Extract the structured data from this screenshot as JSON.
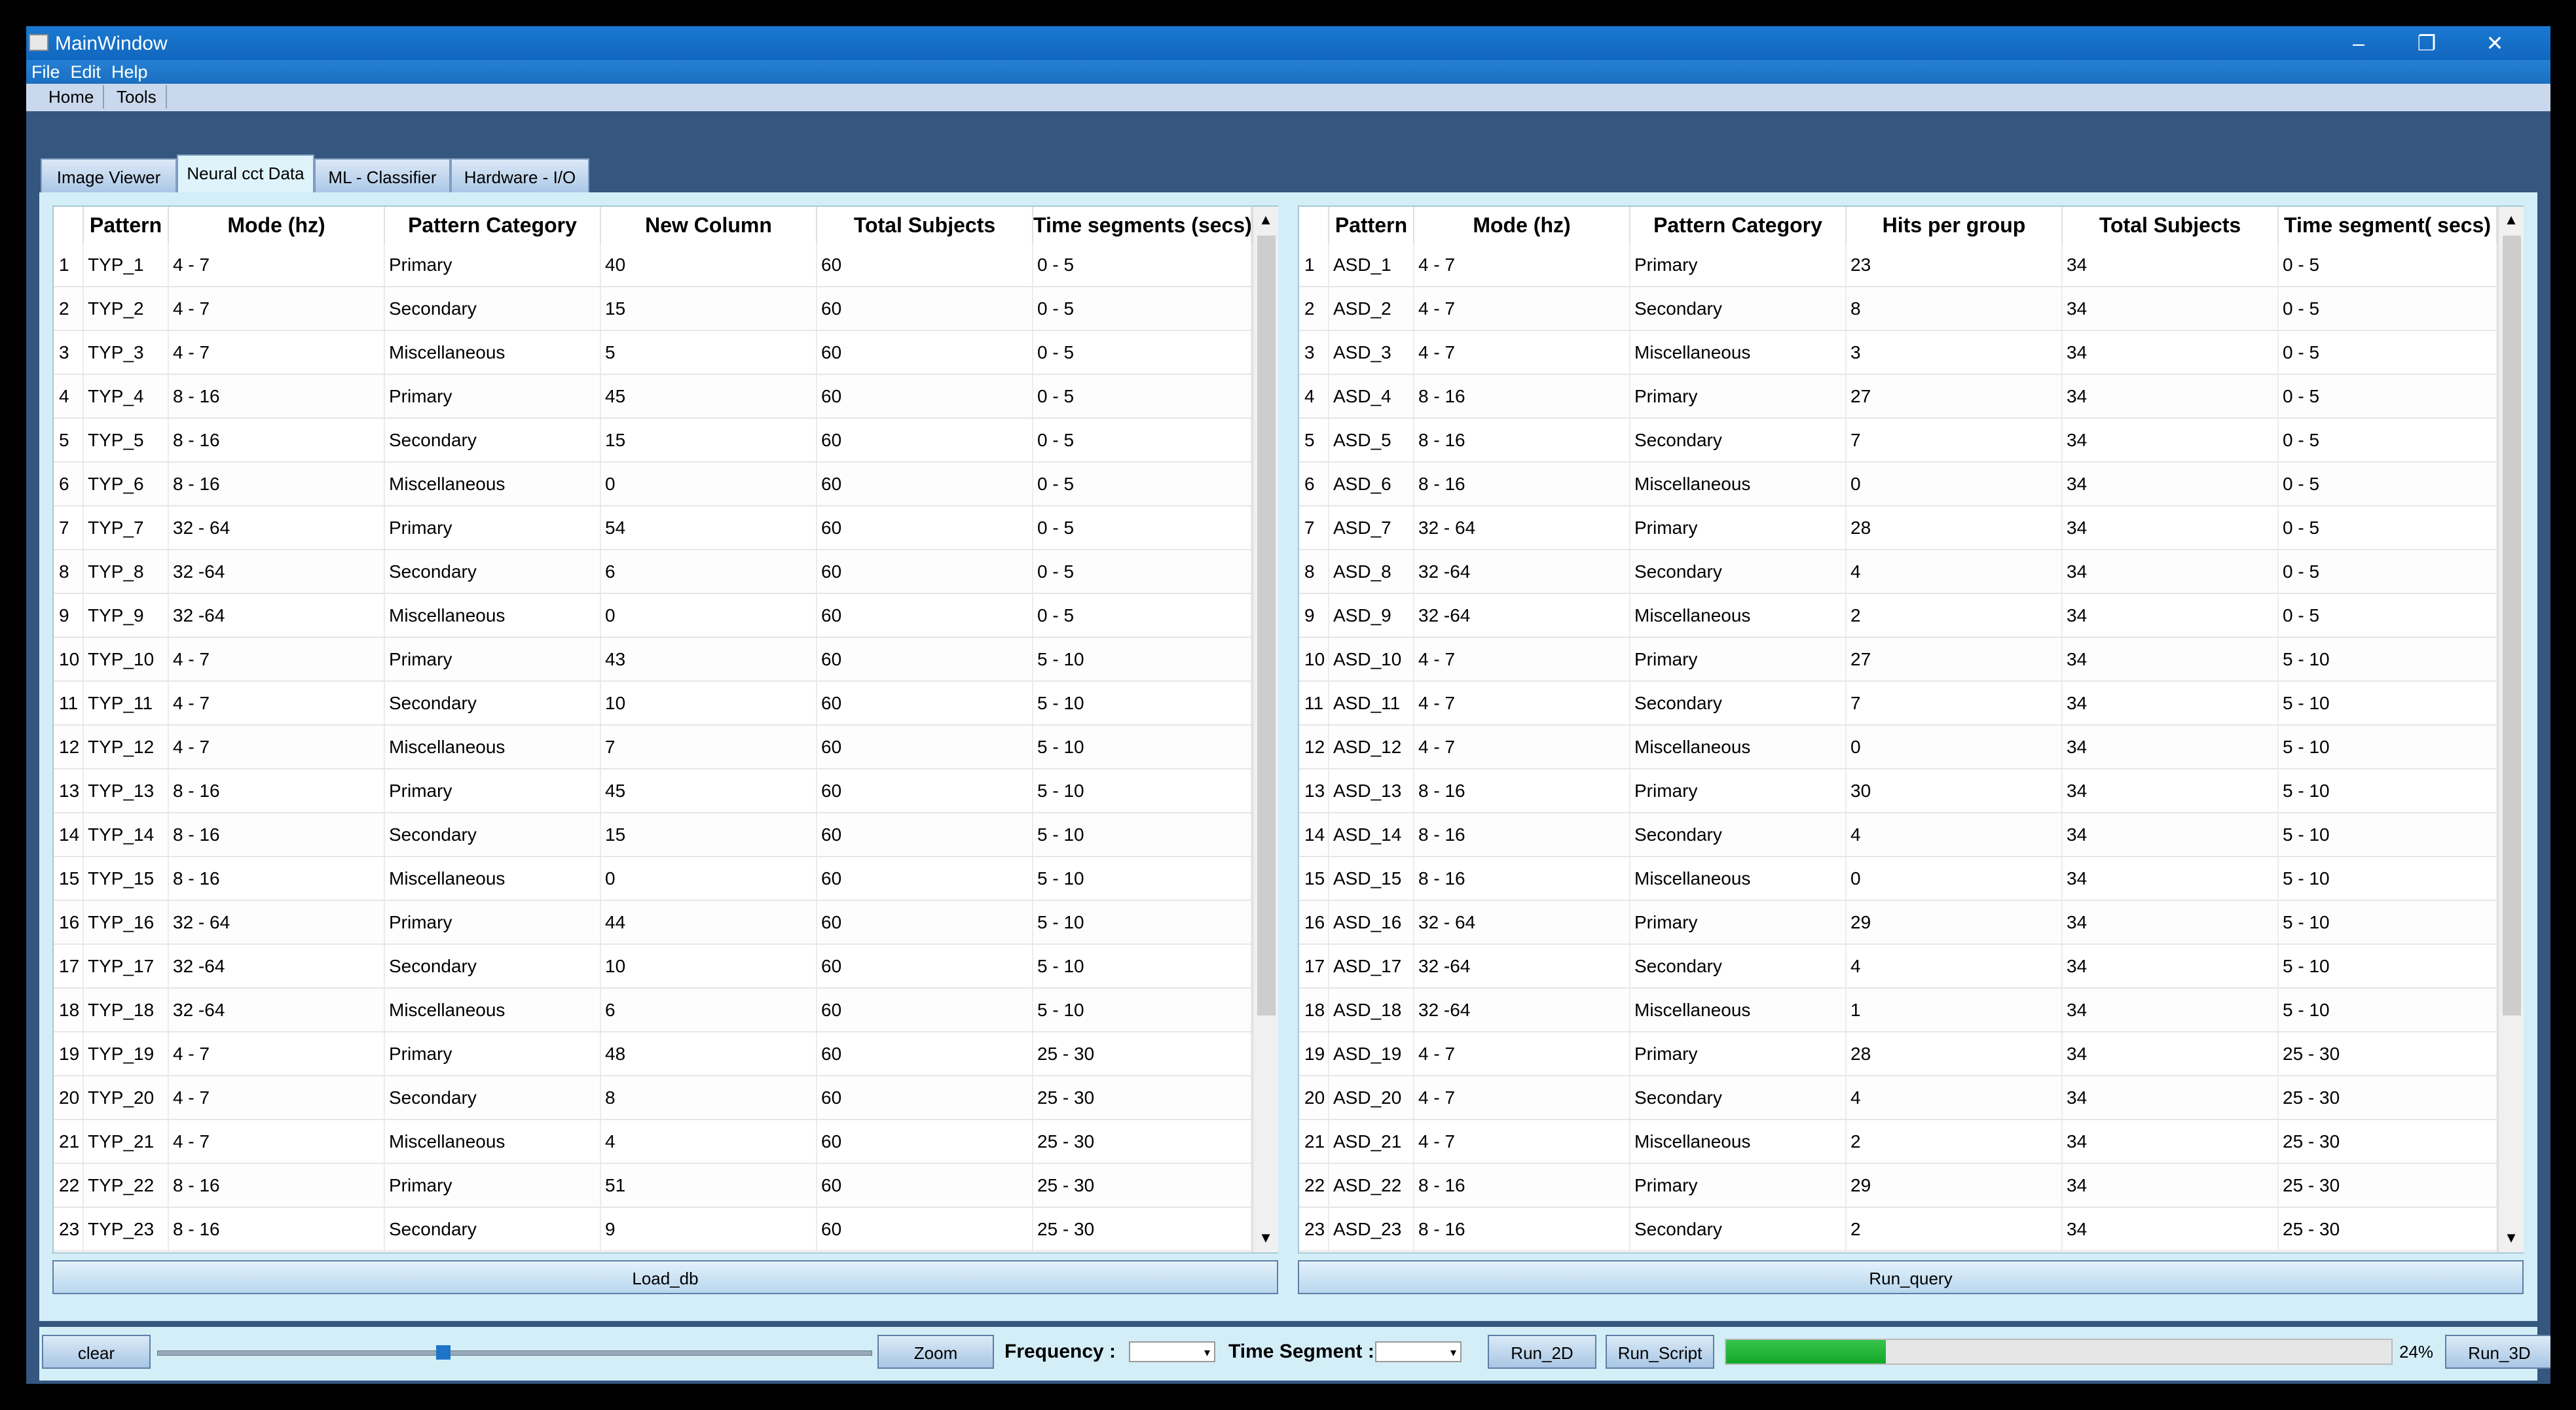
{
  "window": {
    "title": "MainWindow",
    "controls": {
      "minimize": "–",
      "maximize": "❐",
      "close": "✕"
    }
  },
  "menubar": {
    "items": [
      "File",
      "Edit",
      "Help"
    ]
  },
  "toolbar": {
    "items": [
      "Home",
      "Tools"
    ]
  },
  "tabs": [
    "Image Viewer",
    "Neural cct Data",
    "ML - Classifier",
    "Hardware - I/O"
  ],
  "active_tab": "Neural cct Data",
  "left_table": {
    "headers": [
      "Pattern",
      "Mode (hz)",
      "Pattern Category",
      "New Column",
      "Total Subjects",
      "Time segments (secs)"
    ],
    "rows": [
      [
        "1",
        "TYP_1",
        "4 - 7",
        "Primary",
        "40",
        "60",
        "0 - 5"
      ],
      [
        "2",
        "TYP_2",
        "4 - 7",
        "Secondary",
        "15",
        "60",
        "0 - 5"
      ],
      [
        "3",
        "TYP_3",
        "4 - 7",
        "Miscellaneous",
        "5",
        "60",
        "0 - 5"
      ],
      [
        "4",
        "TYP_4",
        "8 - 16",
        "Primary",
        "45",
        "60",
        "0 - 5"
      ],
      [
        "5",
        "TYP_5",
        "8 - 16",
        "Secondary",
        "15",
        "60",
        "0 - 5"
      ],
      [
        "6",
        "TYP_6",
        "8 - 16",
        "Miscellaneous",
        "0",
        "60",
        "0 - 5"
      ],
      [
        "7",
        "TYP_7",
        "32 - 64",
        "Primary",
        "54",
        "60",
        "0 - 5"
      ],
      [
        "8",
        "TYP_8",
        "32 -64",
        "Secondary",
        "6",
        "60",
        "0 - 5"
      ],
      [
        "9",
        "TYP_9",
        "32 -64",
        "Miscellaneous",
        "0",
        "60",
        "0 - 5"
      ],
      [
        "10",
        "TYP_10",
        "4 - 7",
        "Primary",
        "43",
        "60",
        "5 - 10"
      ],
      [
        "11",
        "TYP_11",
        "4 - 7",
        "Secondary",
        "10",
        "60",
        "5 - 10"
      ],
      [
        "12",
        "TYP_12",
        "4 - 7",
        "Miscellaneous",
        "7",
        "60",
        "5 - 10"
      ],
      [
        "13",
        "TYP_13",
        "8 - 16",
        "Primary",
        "45",
        "60",
        "5 - 10"
      ],
      [
        "14",
        "TYP_14",
        "8 - 16",
        "Secondary",
        "15",
        "60",
        "5 - 10"
      ],
      [
        "15",
        "TYP_15",
        "8 - 16",
        "Miscellaneous",
        "0",
        "60",
        "5 - 10"
      ],
      [
        "16",
        "TYP_16",
        "32 - 64",
        "Primary",
        "44",
        "60",
        "5 - 10"
      ],
      [
        "17",
        "TYP_17",
        "32 -64",
        "Secondary",
        "10",
        "60",
        "5 - 10"
      ],
      [
        "18",
        "TYP_18",
        "32 -64",
        "Miscellaneous",
        "6",
        "60",
        "5 - 10"
      ],
      [
        "19",
        "TYP_19",
        "4 - 7",
        "Primary",
        "48",
        "60",
        "25 - 30"
      ],
      [
        "20",
        "TYP_20",
        "4 - 7",
        "Secondary",
        "8",
        "60",
        "25 - 30"
      ],
      [
        "21",
        "TYP_21",
        "4 - 7",
        "Miscellaneous",
        "4",
        "60",
        "25 - 30"
      ],
      [
        "22",
        "TYP_22",
        "8 - 16",
        "Primary",
        "51",
        "60",
        "25 - 30"
      ],
      [
        "23",
        "TYP_23",
        "8 - 16",
        "Secondary",
        "9",
        "60",
        "25 - 30"
      ]
    ]
  },
  "right_table": {
    "headers": [
      "Pattern",
      "Mode (hz)",
      "Pattern Category",
      "Hits per group",
      "Total Subjects",
      "Time segment( secs)"
    ],
    "rows": [
      [
        "1",
        "ASD_1",
        "4 - 7",
        "Primary",
        "23",
        "34",
        "0 - 5"
      ],
      [
        "2",
        "ASD_2",
        "4 - 7",
        "Secondary",
        "8",
        "34",
        "0 - 5"
      ],
      [
        "3",
        "ASD_3",
        "4 - 7",
        "Miscellaneous",
        "3",
        "34",
        "0 - 5"
      ],
      [
        "4",
        "ASD_4",
        "8 - 16",
        "Primary",
        "27",
        "34",
        "0 - 5"
      ],
      [
        "5",
        "ASD_5",
        "8 - 16",
        "Secondary",
        "7",
        "34",
        "0 - 5"
      ],
      [
        "6",
        "ASD_6",
        "8 - 16",
        "Miscellaneous",
        "0",
        "34",
        "0 - 5"
      ],
      [
        "7",
        "ASD_7",
        "32 - 64",
        "Primary",
        "28",
        "34",
        "0 - 5"
      ],
      [
        "8",
        "ASD_8",
        "32 -64",
        "Secondary",
        "4",
        "34",
        "0 - 5"
      ],
      [
        "9",
        "ASD_9",
        "32 -64",
        "Miscellaneous",
        "2",
        "34",
        "0 - 5"
      ],
      [
        "10",
        "ASD_10",
        "4 - 7",
        "Primary",
        "27",
        "34",
        "5 - 10"
      ],
      [
        "11",
        "ASD_11",
        "4 - 7",
        "Secondary",
        "7",
        "34",
        "5 - 10"
      ],
      [
        "12",
        "ASD_12",
        "4 - 7",
        "Miscellaneous",
        "0",
        "34",
        "5 - 10"
      ],
      [
        "13",
        "ASD_13",
        "8 - 16",
        "Primary",
        "30",
        "34",
        "5 - 10"
      ],
      [
        "14",
        "ASD_14",
        "8 - 16",
        "Secondary",
        "4",
        "34",
        "5 - 10"
      ],
      [
        "15",
        "ASD_15",
        "8 - 16",
        "Miscellaneous",
        "0",
        "34",
        "5 - 10"
      ],
      [
        "16",
        "ASD_16",
        "32 - 64",
        "Primary",
        "29",
        "34",
        "5 - 10"
      ],
      [
        "17",
        "ASD_17",
        "32 -64",
        "Secondary",
        "4",
        "34",
        "5 - 10"
      ],
      [
        "18",
        "ASD_18",
        "32 -64",
        "Miscellaneous",
        "1",
        "34",
        "5 - 10"
      ],
      [
        "19",
        "ASD_19",
        "4 - 7",
        "Primary",
        "28",
        "34",
        "25 - 30"
      ],
      [
        "20",
        "ASD_20",
        "4 - 7",
        "Secondary",
        "4",
        "34",
        "25 - 30"
      ],
      [
        "21",
        "ASD_21",
        "4 - 7",
        "Miscellaneous",
        "2",
        "34",
        "25 - 30"
      ],
      [
        "22",
        "ASD_22",
        "8 - 16",
        "Primary",
        "29",
        "34",
        "25 - 30"
      ],
      [
        "23",
        "ASD_23",
        "8 - 16",
        "Secondary",
        "2",
        "34",
        "25 - 30"
      ]
    ]
  },
  "buttons": {
    "load_db": "Load_db",
    "run_query": "Run_query",
    "clear": "clear",
    "zoom": "Zoom",
    "run_2d": "Run_2D",
    "run_script": "Run_Script",
    "run_3d": "Run_3D"
  },
  "labels": {
    "frequency": "Frequency :",
    "time_segment": "Time Segment :"
  },
  "frequency_select": {
    "value": "",
    "dropdown_icon": "chevron-down-icon"
  },
  "time_segment_select": {
    "value": "",
    "dropdown_icon": "chevron-down-icon"
  },
  "zoom_slider": {
    "value_fraction": 0.4
  },
  "progress": {
    "value": 24,
    "text": "24%"
  },
  "colors": {
    "titlebar": "#1a78d0",
    "window_bg": "#3a5a82",
    "panel_bg": "#d4eef8",
    "progress_fill": "#1fb332"
  }
}
